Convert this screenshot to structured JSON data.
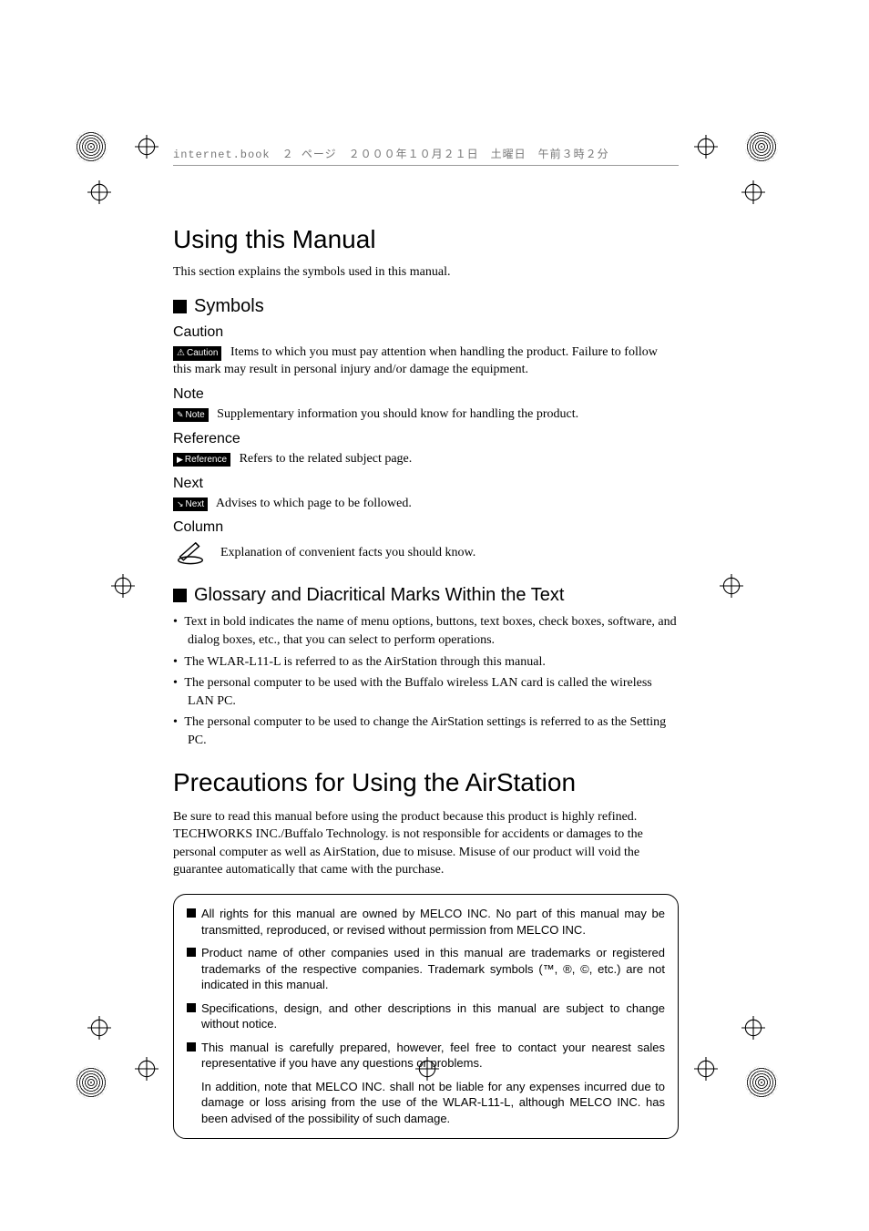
{
  "header": {
    "line": "internet.book　２ ページ　２０００年１０月２１日　土曜日　午前３時２分"
  },
  "title": "Using this Manual",
  "intro": "This section explains the symbols used in this manual.",
  "section_symbols": {
    "title": "Symbols",
    "caution": {
      "heading": "Caution",
      "badge": "Caution",
      "text": "Items to which you must pay attention when handling the product. Failure to follow this mark may result in personal injury and/or damage the equipment."
    },
    "note": {
      "heading": "Note",
      "badge": "Note",
      "text": "Supplementary information you should know for handling the product."
    },
    "reference": {
      "heading": "Reference",
      "badge": "Reference",
      "text": "Refers to the related subject page."
    },
    "next": {
      "heading": "Next",
      "badge": "Next",
      "text": "Advises to which page to be followed."
    },
    "column": {
      "heading": "Column",
      "text": "Explanation of convenient facts you should know."
    }
  },
  "section_glossary": {
    "title": "Glossary and Diacritical Marks Within the Text",
    "bullets": [
      "Text in bold indicates the name of menu options, buttons, text boxes, check boxes, software, and dialog boxes, etc., that you can select to perform operations.",
      "The WLAR-L11-L is referred to as the AirStation through this manual.",
      "The personal computer to be used with the Buffalo wireless LAN card is called the wireless LAN PC.",
      "The personal computer to be used to change the AirStation settings is referred to as the Setting PC."
    ]
  },
  "section_precautions": {
    "title": "Precautions for Using the AirStation",
    "intro": "Be sure to read this manual before using the product because this product is highly refined. TECHWORKS INC./Buffalo Technology. is not responsible for accidents or damages to the personal computer as well as AirStation, due to misuse. Misuse of our product will void the guarantee automatically that came with the purchase.",
    "box": [
      "All rights for this manual are owned by MELCO INC. No part of this manual may be transmitted, reproduced, or revised without permission from MELCO INC.",
      "Product name of other companies used in this manual are trademarks or registered trademarks of the respective companies. Trademark symbols (™, ®, ©, etc.) are not indicated in this manual.",
      "Specifications, design, and other descriptions in this manual are subject to change without notice.",
      "This manual is carefully prepared, however, feel free to contact your nearest sales representative if you have any questions or problems."
    ],
    "box_addendum": "In addition, note that MELCO INC. shall not be liable for any expenses incurred due to damage or loss arising from the use of the WLAR-L11-L, although MELCO INC. has been advised of the possibility of such damage."
  }
}
